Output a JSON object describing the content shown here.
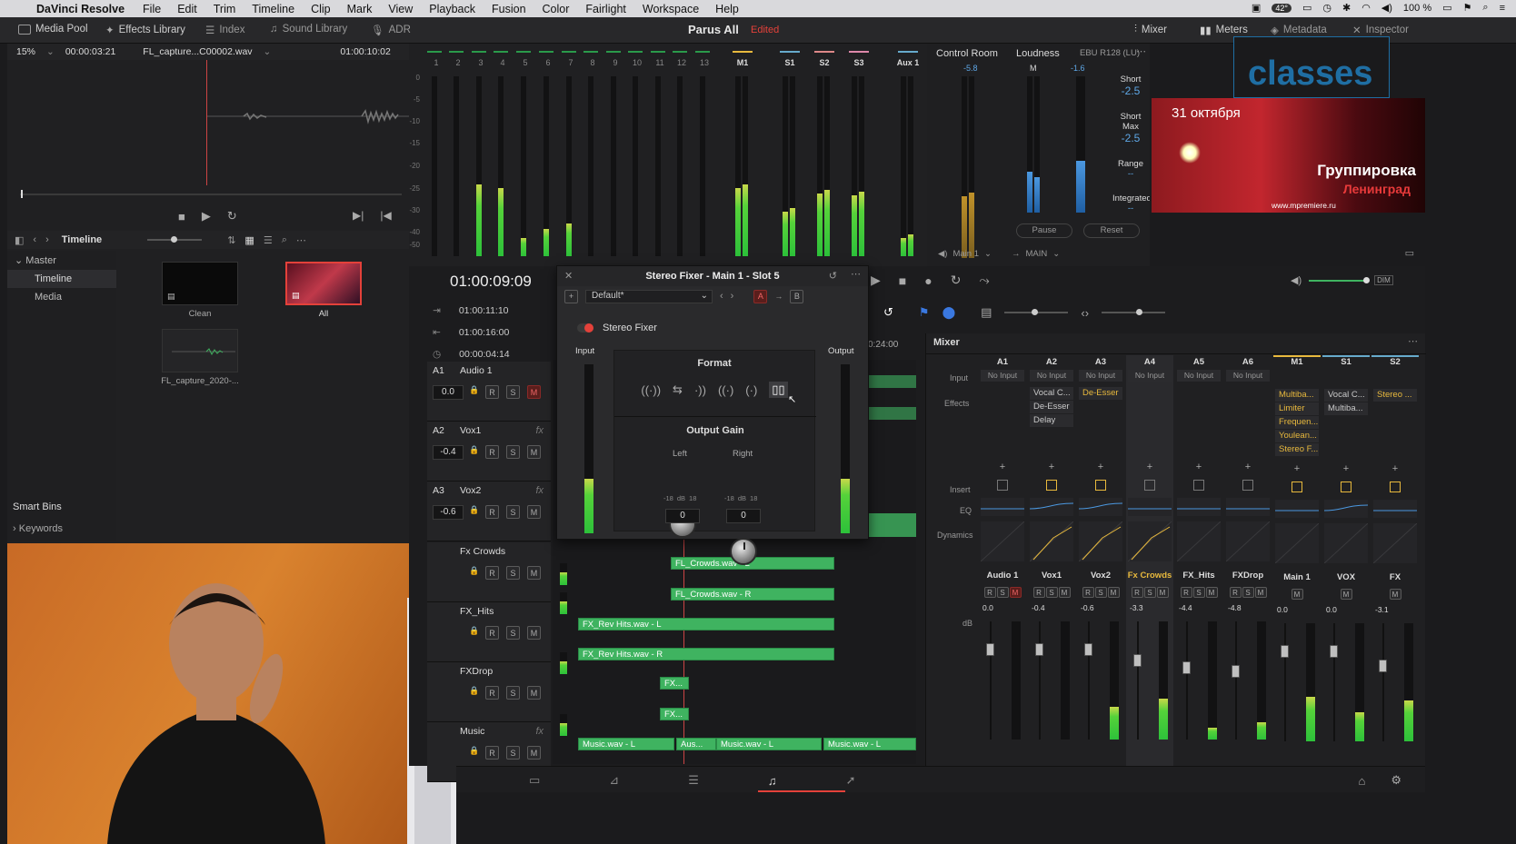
{
  "menubar": {
    "apple": "",
    "app": "DaVinci Resolve",
    "items": [
      "File",
      "Edit",
      "Trim",
      "Timeline",
      "Clip",
      "Mark",
      "View",
      "Playback",
      "Fusion",
      "Color",
      "Fairlight",
      "Workspace",
      "Help"
    ],
    "battery": "100 %",
    "temp": "42°"
  },
  "toolbar": {
    "media_pool": "Media Pool",
    "effects_library": "Effects Library",
    "index": "Index",
    "sound_library": "Sound Library",
    "adr": "ADR",
    "project_title": "Parus All",
    "edited": "Edited",
    "mixer": "Mixer",
    "meters": "Meters",
    "metadata": "Metadata",
    "inspector": "Inspector"
  },
  "viewer": {
    "zoom": "15%",
    "timecode": "00:00:03:21",
    "clip_name": "FL_capture...C00002.wav",
    "end_timecode": "01:00:10:02"
  },
  "media_pool": {
    "title": "Timeline",
    "tree": [
      "Master",
      "Timeline",
      "Media"
    ],
    "smart_bins": "Smart Bins",
    "keywords": "Keywords",
    "clips": [
      {
        "name": "Clean"
      },
      {
        "name": "All"
      },
      {
        "name": "FL_capture_2020-..."
      }
    ]
  },
  "meters": {
    "channels": [
      "1",
      "2",
      "3",
      "4",
      "5",
      "6",
      "7",
      "8",
      "9",
      "10",
      "11",
      "12",
      "13"
    ],
    "channel_levels": [
      0,
      0,
      0.4,
      0.38,
      0.1,
      0.15,
      0.18,
      0,
      0,
      0,
      0,
      0,
      0
    ],
    "bus_labels": [
      "M1",
      "S1",
      "S2",
      "S3",
      "Aux 1"
    ],
    "bus_levels": [
      0.38,
      0.25,
      0.35,
      0.34,
      0.1
    ],
    "scale": [
      "0",
      "-5",
      "-10",
      "-15",
      "-20",
      "-25",
      "-30",
      "-40",
      "-50"
    ],
    "control_room": "Control Room",
    "control_room_value": "-5.8",
    "loudness": "Loudness",
    "loudness_std": "EBU R128 (LU)",
    "loudness_m": "M",
    "loudness_m_value": "-1.6",
    "short_label": "Short",
    "short_value": "-2.5",
    "short_max_label": "Short Max",
    "short_max_value": "-2.5",
    "range_label": "Range",
    "range_value": "--",
    "integrated_label": "Integrated",
    "integrated_value": "--",
    "pause": "Pause",
    "reset": "Reset",
    "main_select": "Main 1",
    "main_out": "MAIN"
  },
  "video_overlay": {
    "brand": "classes",
    "date": "31 октября",
    "band_line1": "Группировка",
    "band_line2": "Ленинград",
    "site": "www.mpremiere.ru"
  },
  "timeline": {
    "timecode": "01:00:09:09",
    "in_tc": "01:00:11:10",
    "out_tc": "01:00:16:00",
    "dur_tc": "00:00:04:14",
    "ruler_mark": "0:24:00",
    "tracks": [
      {
        "id": "A1",
        "name": "Audio 1",
        "level": "0.0"
      },
      {
        "id": "A2",
        "name": "Vox1",
        "level": "-0.4"
      },
      {
        "id": "A3",
        "name": "Vox2",
        "level": "-0.6"
      },
      {
        "id": "",
        "name": "Fx Crowds",
        "level": ""
      },
      {
        "id": "",
        "name": "FX_Hits",
        "level": ""
      },
      {
        "id": "",
        "name": "FXDrop",
        "level": ""
      },
      {
        "id": "",
        "name": "Music",
        "level": ""
      }
    ],
    "clips": [
      {
        "label": "FL_Crowds.wav - L"
      },
      {
        "label": "FL_Crowds.wav - R"
      },
      {
        "label": "FX_Rev Hits.wav - L"
      },
      {
        "label": "FX_Rev Hits.wav - R"
      },
      {
        "label": "FX..."
      },
      {
        "label": "FX..."
      },
      {
        "label": "Music.wav - L"
      },
      {
        "label": "Aus..."
      },
      {
        "label": "Music.wav - L"
      },
      {
        "label": "Music.wav - L"
      }
    ]
  },
  "plugin": {
    "title": "Stereo Fixer - Main 1 - Slot 5",
    "preset": "Default*",
    "ab_a": "A",
    "ab_arrow": "→",
    "ab_b": "B",
    "name": "Stereo Fixer",
    "input_label": "Input",
    "output_label": "Output",
    "format_label": "Format",
    "output_gain_label": "Output Gain",
    "left_label": "Left",
    "right_label": "Right",
    "knob_scale_lo": "-18",
    "knob_scale_mid": "dB",
    "knob_scale_hi": "18",
    "left_value": "0",
    "right_value": "0",
    "input_level": 0.32,
    "output_level": 0.32
  },
  "mixer": {
    "title": "Mixer",
    "row_labels": {
      "input": "Input",
      "effects": "Effects",
      "insert": "Insert",
      "eq": "EQ",
      "dynamics": "Dynamics",
      "db": "dB"
    },
    "channels": [
      {
        "head": "A1",
        "input": "No Input",
        "effects": [],
        "name": "Audio 1",
        "db": "0.0",
        "level": 0
      },
      {
        "head": "A2",
        "input": "No Input",
        "effects": [
          "Vocal C...",
          "De-Esser",
          "Delay"
        ],
        "name": "Vox1",
        "db": "-0.4",
        "level": 0
      },
      {
        "head": "A3",
        "input": "No Input",
        "effects": [
          "De-Esser"
        ],
        "name": "Vox2",
        "db": "-0.6",
        "level": 0.28
      },
      {
        "head": "A4",
        "input": "No Input",
        "effects": [],
        "name": "Fx Crowds",
        "db": "-3.3",
        "level": 0.35
      },
      {
        "head": "A5",
        "input": "No Input",
        "effects": [],
        "name": "FX_Hits",
        "db": "-4.4",
        "level": 0.1
      },
      {
        "head": "A6",
        "input": "No Input",
        "effects": [],
        "name": "FXDrop",
        "db": "-4.8",
        "level": 0.15
      },
      {
        "head": "M1",
        "input": "",
        "effects": [
          "Multiba...",
          "Limiter",
          "Frequen...",
          "Youlean...",
          "Stereo F..."
        ],
        "name": "Main 1",
        "db": "0.0",
        "level": 0.38
      },
      {
        "head": "S1",
        "input": "",
        "effects": [
          "Vocal C...",
          "Multiba..."
        ],
        "name": "VOX",
        "db": "0.0",
        "level": 0.25
      },
      {
        "head": "S2",
        "input": "",
        "effects": [
          "Stereo ..."
        ],
        "name": "FX",
        "db": "-3.1",
        "level": 0.35
      }
    ]
  },
  "colors": {
    "accent_red": "#e4413a",
    "meter_green": "#2dc13a",
    "clip_green": "#3fb360",
    "fx_yellow": "#e8b93d",
    "brand_blue": "#1f6ea3"
  }
}
